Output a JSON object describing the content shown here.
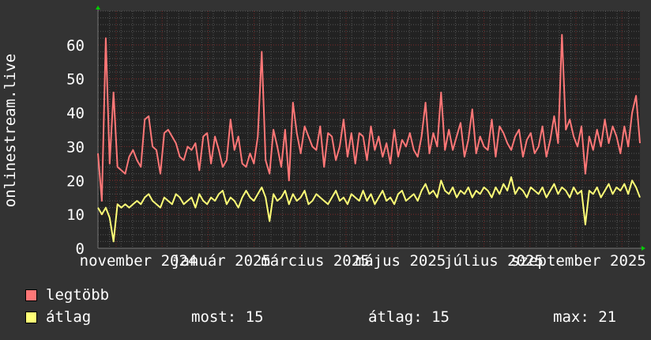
{
  "colors": {
    "background": "#333333",
    "plot": "#222222",
    "max": "#ff7777",
    "avg": "#ffff77",
    "grid_minor": "#555555",
    "grid_major": "#772222",
    "arrow": "#00cc00"
  },
  "chart_data": {
    "type": "line",
    "ylabel": "onlinestream.live",
    "ylim": [
      0,
      70
    ],
    "yticks": [
      0,
      10,
      20,
      30,
      40,
      50,
      60
    ],
    "xtick_labels": [
      "november 2024",
      "január 2025",
      "március 2025",
      "május 2025",
      "július 2025",
      "szeptember 2025"
    ],
    "series": [
      {
        "name": "legtöbb",
        "values": [
          28,
          14,
          62,
          25,
          46,
          24,
          23,
          22,
          27,
          29,
          26,
          24,
          38,
          39,
          30,
          29,
          22,
          34,
          35,
          33,
          31,
          27,
          26,
          30,
          29,
          31,
          23,
          33,
          34,
          25,
          33,
          29,
          24,
          26,
          38,
          29,
          33,
          25,
          24,
          28,
          25,
          33,
          58,
          26,
          22,
          35,
          30,
          24,
          35,
          20,
          43,
          34,
          28,
          36,
          33,
          30,
          29,
          36,
          24,
          34,
          33,
          26,
          30,
          38,
          27,
          34,
          25,
          34,
          33,
          26,
          36,
          29,
          33,
          27,
          31,
          25,
          35,
          27,
          32,
          30,
          34,
          29,
          27,
          33,
          43,
          28,
          34,
          30,
          46,
          29,
          35,
          29,
          33,
          37,
          27,
          32,
          41,
          28,
          33,
          30,
          29,
          38,
          27,
          36,
          34,
          31,
          29,
          33,
          35,
          27,
          32,
          34,
          28,
          30,
          36,
          27,
          32,
          39,
          31,
          63,
          35,
          38,
          33,
          30,
          36,
          22,
          33,
          29,
          35,
          30,
          38,
          31,
          36,
          33,
          28,
          36,
          30,
          40,
          45,
          31
        ]
      },
      {
        "name": "átlag",
        "values": [
          12,
          10,
          12,
          9,
          2,
          13,
          12,
          13,
          12,
          13,
          14,
          13,
          15,
          16,
          14,
          13,
          12,
          15,
          14,
          13,
          16,
          15,
          13,
          14,
          15,
          12,
          16,
          14,
          13,
          15,
          14,
          16,
          17,
          13,
          15,
          14,
          12,
          15,
          17,
          15,
          14,
          16,
          18,
          15,
          8,
          16,
          14,
          15,
          17,
          13,
          16,
          14,
          15,
          17,
          13,
          14,
          16,
          15,
          14,
          13,
          15,
          17,
          14,
          15,
          13,
          16,
          15,
          14,
          17,
          14,
          16,
          13,
          15,
          17,
          14,
          15,
          13,
          16,
          17,
          14,
          15,
          16,
          14,
          17,
          19,
          16,
          17,
          15,
          20,
          17,
          16,
          18,
          15,
          17,
          16,
          18,
          15,
          17,
          16,
          18,
          17,
          15,
          18,
          16,
          19,
          17,
          21,
          16,
          18,
          17,
          15,
          18,
          17,
          16,
          18,
          15,
          17,
          19,
          16,
          18,
          17,
          15,
          18,
          16,
          17,
          7,
          17,
          16,
          18,
          15,
          17,
          19,
          16,
          18,
          17,
          19,
          16,
          20,
          18,
          15
        ]
      }
    ]
  },
  "legend": {
    "max_label": "legtöbb",
    "avg_label": "átlag",
    "now": "most: 15",
    "average": "átlag: 15",
    "maximum": "max: 21"
  }
}
